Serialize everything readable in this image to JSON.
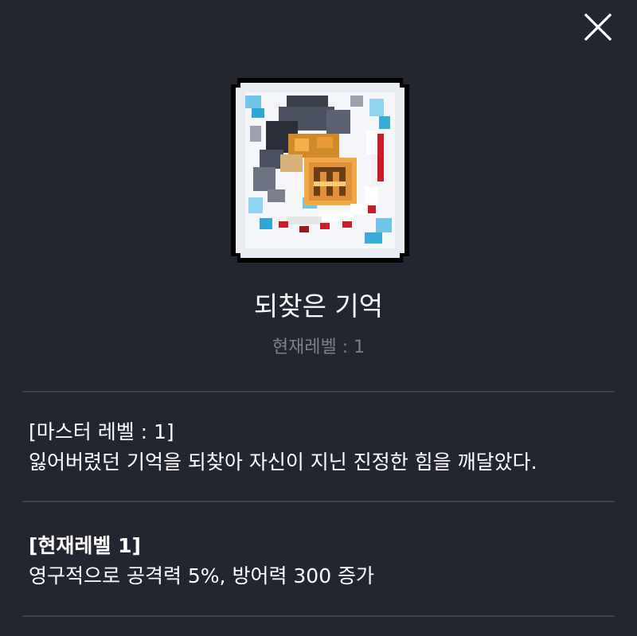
{
  "dialog": {
    "close_icon": "close-icon",
    "skill_icon": "pixel-art-skill-icon"
  },
  "skill": {
    "name": "되찾은 기억",
    "current_level": "현재레벨 : 1"
  },
  "master_section": {
    "title": "[마스터 레벨 : 1]",
    "description": "잃어버렸던 기억을 되찾아 자신이 지닌 진정한 힘을 깨달았다."
  },
  "current_section": {
    "title": "[현재레벨 1]",
    "description": "영구적으로 공격력 5%, 방어력 300 증가"
  },
  "colors": {
    "background": "#232630",
    "divider": "#3d414c",
    "muted_text": "#7d8088"
  }
}
